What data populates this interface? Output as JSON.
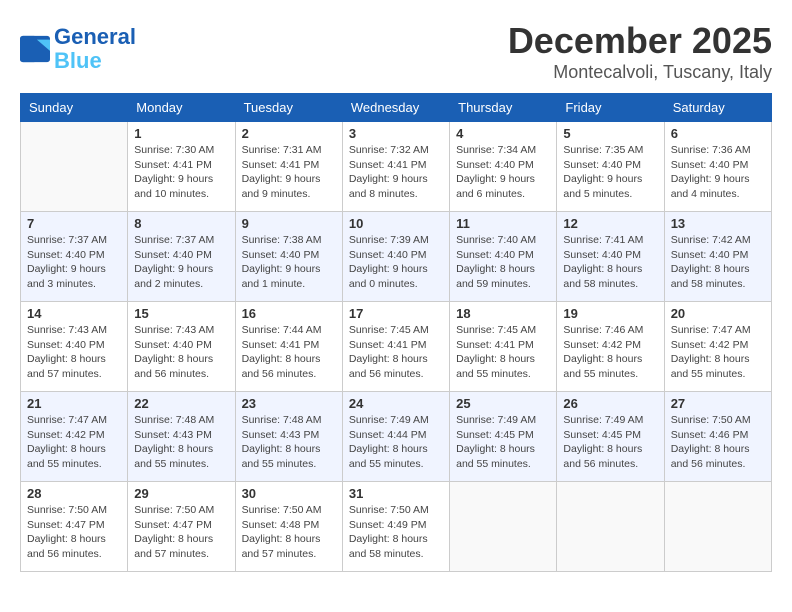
{
  "header": {
    "logo_line1": "General",
    "logo_line2": "Blue",
    "month": "December 2025",
    "location": "Montecalvoli, Tuscany, Italy"
  },
  "weekdays": [
    "Sunday",
    "Monday",
    "Tuesday",
    "Wednesday",
    "Thursday",
    "Friday",
    "Saturday"
  ],
  "weeks": [
    [
      {
        "day": "",
        "info": ""
      },
      {
        "day": "1",
        "info": "Sunrise: 7:30 AM\nSunset: 4:41 PM\nDaylight: 9 hours\nand 10 minutes."
      },
      {
        "day": "2",
        "info": "Sunrise: 7:31 AM\nSunset: 4:41 PM\nDaylight: 9 hours\nand 9 minutes."
      },
      {
        "day": "3",
        "info": "Sunrise: 7:32 AM\nSunset: 4:41 PM\nDaylight: 9 hours\nand 8 minutes."
      },
      {
        "day": "4",
        "info": "Sunrise: 7:34 AM\nSunset: 4:40 PM\nDaylight: 9 hours\nand 6 minutes."
      },
      {
        "day": "5",
        "info": "Sunrise: 7:35 AM\nSunset: 4:40 PM\nDaylight: 9 hours\nand 5 minutes."
      },
      {
        "day": "6",
        "info": "Sunrise: 7:36 AM\nSunset: 4:40 PM\nDaylight: 9 hours\nand 4 minutes."
      }
    ],
    [
      {
        "day": "7",
        "info": "Sunrise: 7:37 AM\nSunset: 4:40 PM\nDaylight: 9 hours\nand 3 minutes."
      },
      {
        "day": "8",
        "info": "Sunrise: 7:37 AM\nSunset: 4:40 PM\nDaylight: 9 hours\nand 2 minutes."
      },
      {
        "day": "9",
        "info": "Sunrise: 7:38 AM\nSunset: 4:40 PM\nDaylight: 9 hours\nand 1 minute."
      },
      {
        "day": "10",
        "info": "Sunrise: 7:39 AM\nSunset: 4:40 PM\nDaylight: 9 hours\nand 0 minutes."
      },
      {
        "day": "11",
        "info": "Sunrise: 7:40 AM\nSunset: 4:40 PM\nDaylight: 8 hours\nand 59 minutes."
      },
      {
        "day": "12",
        "info": "Sunrise: 7:41 AM\nSunset: 4:40 PM\nDaylight: 8 hours\nand 58 minutes."
      },
      {
        "day": "13",
        "info": "Sunrise: 7:42 AM\nSunset: 4:40 PM\nDaylight: 8 hours\nand 58 minutes."
      }
    ],
    [
      {
        "day": "14",
        "info": "Sunrise: 7:43 AM\nSunset: 4:40 PM\nDaylight: 8 hours\nand 57 minutes."
      },
      {
        "day": "15",
        "info": "Sunrise: 7:43 AM\nSunset: 4:40 PM\nDaylight: 8 hours\nand 56 minutes."
      },
      {
        "day": "16",
        "info": "Sunrise: 7:44 AM\nSunset: 4:41 PM\nDaylight: 8 hours\nand 56 minutes."
      },
      {
        "day": "17",
        "info": "Sunrise: 7:45 AM\nSunset: 4:41 PM\nDaylight: 8 hours\nand 56 minutes."
      },
      {
        "day": "18",
        "info": "Sunrise: 7:45 AM\nSunset: 4:41 PM\nDaylight: 8 hours\nand 55 minutes."
      },
      {
        "day": "19",
        "info": "Sunrise: 7:46 AM\nSunset: 4:42 PM\nDaylight: 8 hours\nand 55 minutes."
      },
      {
        "day": "20",
        "info": "Sunrise: 7:47 AM\nSunset: 4:42 PM\nDaylight: 8 hours\nand 55 minutes."
      }
    ],
    [
      {
        "day": "21",
        "info": "Sunrise: 7:47 AM\nSunset: 4:42 PM\nDaylight: 8 hours\nand 55 minutes."
      },
      {
        "day": "22",
        "info": "Sunrise: 7:48 AM\nSunset: 4:43 PM\nDaylight: 8 hours\nand 55 minutes."
      },
      {
        "day": "23",
        "info": "Sunrise: 7:48 AM\nSunset: 4:43 PM\nDaylight: 8 hours\nand 55 minutes."
      },
      {
        "day": "24",
        "info": "Sunrise: 7:49 AM\nSunset: 4:44 PM\nDaylight: 8 hours\nand 55 minutes."
      },
      {
        "day": "25",
        "info": "Sunrise: 7:49 AM\nSunset: 4:45 PM\nDaylight: 8 hours\nand 55 minutes."
      },
      {
        "day": "26",
        "info": "Sunrise: 7:49 AM\nSunset: 4:45 PM\nDaylight: 8 hours\nand 56 minutes."
      },
      {
        "day": "27",
        "info": "Sunrise: 7:50 AM\nSunset: 4:46 PM\nDaylight: 8 hours\nand 56 minutes."
      }
    ],
    [
      {
        "day": "28",
        "info": "Sunrise: 7:50 AM\nSunset: 4:47 PM\nDaylight: 8 hours\nand 56 minutes."
      },
      {
        "day": "29",
        "info": "Sunrise: 7:50 AM\nSunset: 4:47 PM\nDaylight: 8 hours\nand 57 minutes."
      },
      {
        "day": "30",
        "info": "Sunrise: 7:50 AM\nSunset: 4:48 PM\nDaylight: 8 hours\nand 57 minutes."
      },
      {
        "day": "31",
        "info": "Sunrise: 7:50 AM\nSunset: 4:49 PM\nDaylight: 8 hours\nand 58 minutes."
      },
      {
        "day": "",
        "info": ""
      },
      {
        "day": "",
        "info": ""
      },
      {
        "day": "",
        "info": ""
      }
    ]
  ]
}
